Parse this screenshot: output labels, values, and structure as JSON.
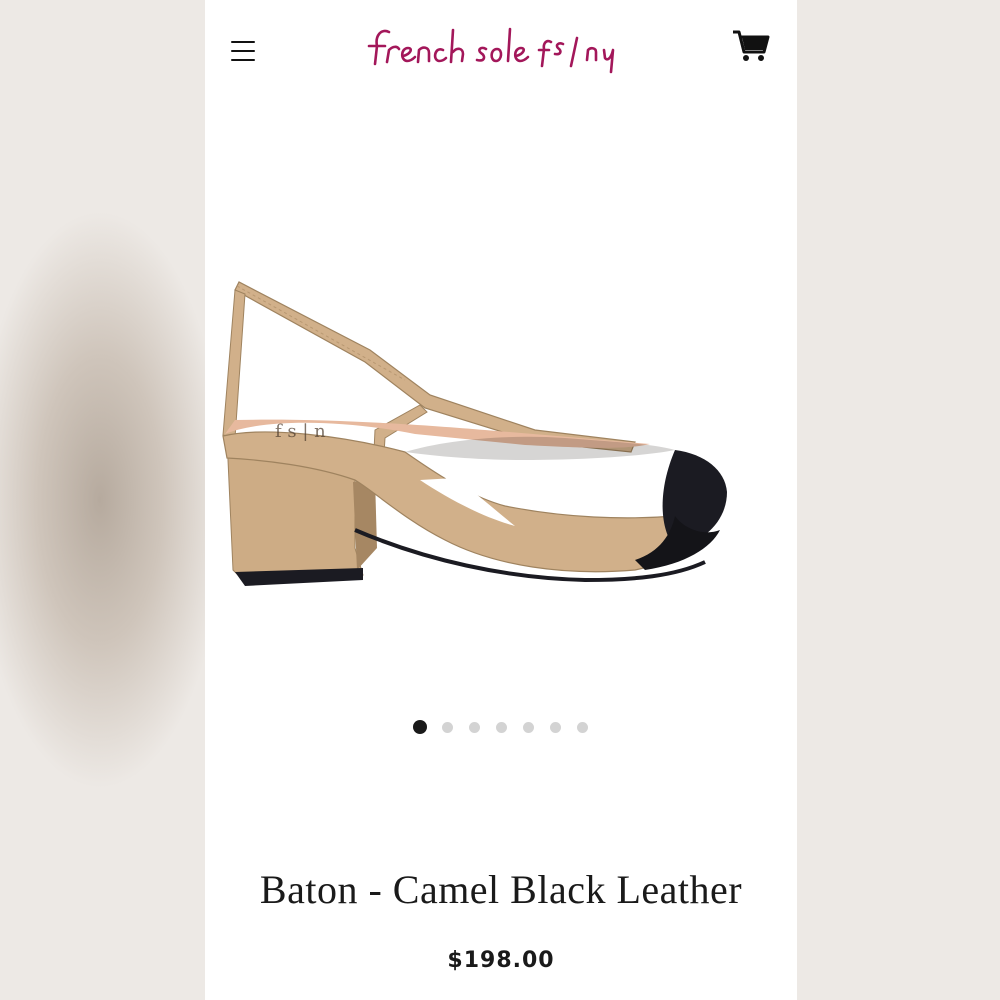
{
  "brand": {
    "name": "french sole fs/ny",
    "color": "#a3175a"
  },
  "icons": {
    "menu": "hamburger-menu-icon",
    "cart": "shopping-cart-icon"
  },
  "product": {
    "title": "Baton - Camel Black Leather",
    "price": "$198.00",
    "image_alt": "Camel slingback block-heel pump with black cap toe",
    "colors": {
      "camel": "#cdae89",
      "black": "#1b1b22"
    }
  },
  "carousel": {
    "total": 7,
    "active_index": 0
  }
}
